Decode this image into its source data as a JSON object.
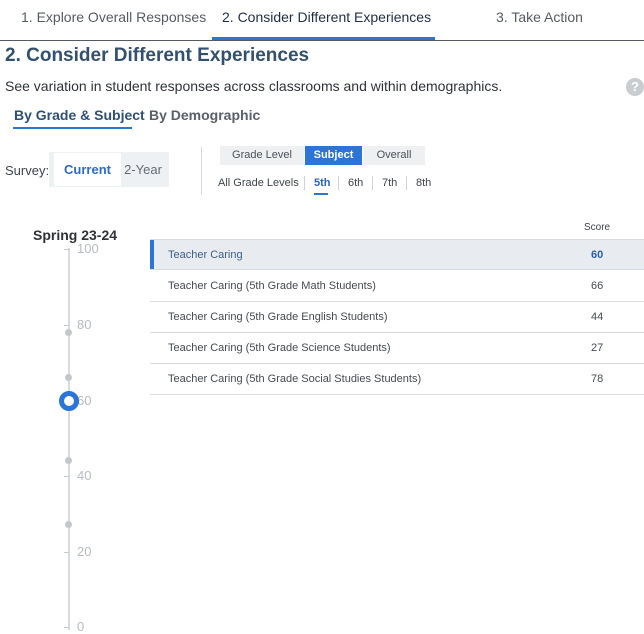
{
  "steps": {
    "items": [
      {
        "label": "1. Explore Overall Responses"
      },
      {
        "label": "2. Consider Different Experiences"
      },
      {
        "label": "3. Take Action"
      }
    ],
    "active_index": 1
  },
  "page": {
    "title": "2. Consider Different Experiences",
    "description": "See variation in student responses across classrooms and within demographics.",
    "help_icon": "question-mark-icon"
  },
  "view_tabs": {
    "items": [
      {
        "label": "By Grade & Subject"
      },
      {
        "label": "By Demographic"
      }
    ],
    "active_index": 0
  },
  "survey": {
    "label": "Survey:",
    "options": [
      {
        "label": "Current"
      },
      {
        "label": "2-Year"
      }
    ],
    "selected": "Current"
  },
  "breakdown": {
    "options": [
      {
        "label": "Grade Level"
      },
      {
        "label": "Subject"
      },
      {
        "label": "Overall"
      }
    ],
    "selected": "Subject"
  },
  "grades": {
    "items": [
      {
        "label": "All Grade Levels"
      },
      {
        "label": "5th"
      },
      {
        "label": "6th"
      },
      {
        "label": "7th"
      },
      {
        "label": "8th"
      }
    ],
    "selected": "5th"
  },
  "slider": {
    "period_label": "Spring 23-24",
    "ticks": [
      "100",
      "80",
      "60",
      "40",
      "20",
      "0"
    ],
    "value": 60,
    "accent_color": "#2b75d6"
  },
  "table": {
    "score_header": "Score",
    "rows": [
      {
        "label": "Teacher Caring",
        "score": "60"
      },
      {
        "label": "Teacher Caring (5th Grade Math Students)",
        "score": "66"
      },
      {
        "label": "Teacher Caring (5th Grade English Students)",
        "score": "44"
      },
      {
        "label": "Teacher Caring (5th Grade Science Students)",
        "score": "27"
      },
      {
        "label": "Teacher Caring (5th Grade Social Studies Students)",
        "score": "78"
      }
    ]
  }
}
